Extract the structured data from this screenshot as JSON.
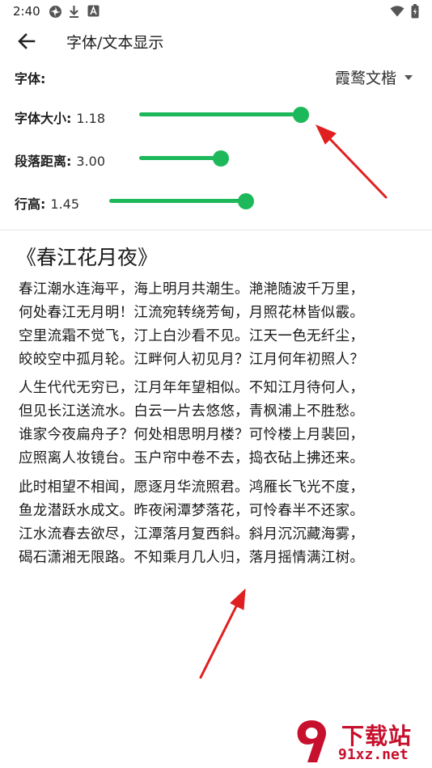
{
  "status_bar": {
    "time": "2:40",
    "left_icons": [
      "photos-icon",
      "download-icon",
      "app-a-icon"
    ],
    "right_icons": [
      "wifi-icon",
      "battery-icon"
    ]
  },
  "app_bar": {
    "title": "字体/文本显示"
  },
  "settings": {
    "font": {
      "label": "字体:",
      "value": "霞鹜文楷"
    },
    "font_size": {
      "label": "字体大小:",
      "value": "1.18",
      "level": 0.95
    },
    "paragraph_spacing": {
      "label": "段落距离:",
      "value": "3.00",
      "level": 0.5
    },
    "line_height": {
      "label": "行高:",
      "value": "1.45",
      "level": 0.5
    }
  },
  "colors": {
    "accent": "#1cb85a",
    "annotation_arrow": "#e02020",
    "watermark": "#c7102d"
  },
  "preview": {
    "title": "《春江花月夜》",
    "paragraphs": [
      [
        "春江潮水连海平，海上明月共潮生。滟滟随波千万里，",
        "何处春江无月明！江流宛转绕芳甸，月照花林皆似霰。",
        "空里流霜不觉飞，汀上白沙看不见。江天一色无纤尘，",
        "皎皎空中孤月轮。江畔何人初见月？江月何年初照人？"
      ],
      [
        "人生代代无穷已，江月年年望相似。不知江月待何人，",
        "但见长江送流水。白云一片去悠悠，青枫浦上不胜愁。",
        "谁家今夜扁舟子？何处相思明月楼？可怜楼上月裴回，",
        "应照离人妆镜台。玉户帘中卷不去，捣衣砧上拂还来。"
      ],
      [
        "此时相望不相闻，愿逐月华流照君。鸿雁长飞光不度，",
        "鱼龙潜跃水成文。昨夜闲潭梦落花，可怜春半不还家。",
        "江水流春去欲尽，江潭落月复西斜。斜月沉沉藏海雾，",
        "碣石潇湘无限路。不知乘月几人归，落月摇情满江树。"
      ]
    ]
  },
  "watermark": {
    "name": "下载站",
    "url": "91xz.net"
  }
}
